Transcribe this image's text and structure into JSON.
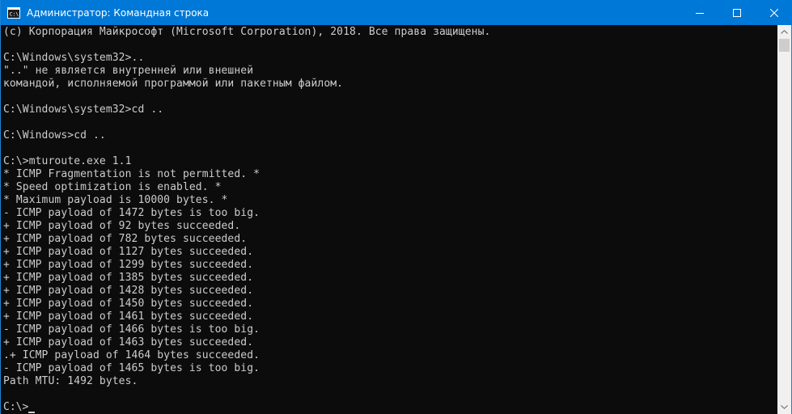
{
  "window": {
    "title": "Администратор: Командная строка",
    "icon": "cmd-icon",
    "accent_color": "#0078d7"
  },
  "caption": {
    "minimize_icon": "minimize-icon",
    "maximize_icon": "maximize-icon",
    "close_icon": "close-icon"
  },
  "console": {
    "text_color": "#cccccc",
    "background": "#0c0c0c",
    "lines": [
      "(c) Корпорация Майкрософт (Microsoft Corporation), 2018. Все права защищены.",
      "",
      "C:\\Windows\\system32>..",
      "\"..\" не является внутренней или внешней",
      "командой, исполняемой программой или пакетным файлом.",
      "",
      "C:\\Windows\\system32>cd ..",
      "",
      "C:\\Windows>cd ..",
      "",
      "C:\\>mturoute.exe 1.1",
      "* ICMP Fragmentation is not permitted. *",
      "* Speed optimization is enabled. *",
      "* Maximum payload is 10000 bytes. *",
      "- ICMP payload of 1472 bytes is too big.",
      "+ ICMP payload of 92 bytes succeeded.",
      "+ ICMP payload of 782 bytes succeeded.",
      "+ ICMP payload of 1127 bytes succeeded.",
      "+ ICMP payload of 1299 bytes succeeded.",
      "+ ICMP payload of 1385 bytes succeeded.",
      "+ ICMP payload of 1428 bytes succeeded.",
      "+ ICMP payload of 1450 bytes succeeded.",
      "+ ICMP payload of 1461 bytes succeeded.",
      "- ICMP payload of 1466 bytes is too big.",
      "+ ICMP payload of 1463 bytes succeeded.",
      ".+ ICMP payload of 1464 bytes succeeded.",
      "- ICMP payload of 1465 bytes is too big.",
      "Path MTU: 1492 bytes.",
      ""
    ],
    "prompt": "C:\\>"
  },
  "scrollbar": {
    "up_icon": "scroll-up-arrow-icon",
    "down_icon": "scroll-down-arrow-icon"
  }
}
